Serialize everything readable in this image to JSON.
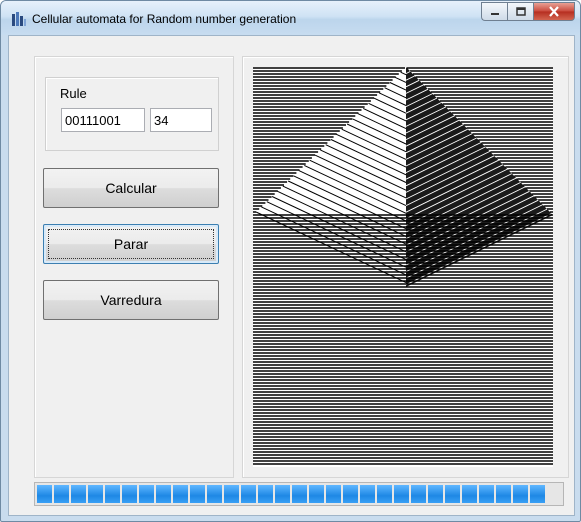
{
  "window": {
    "title": "Cellular automata for Random number generation"
  },
  "caption_buttons": {
    "minimize": "—",
    "maximize": "□",
    "close": "X"
  },
  "rule": {
    "label": "Rule",
    "bits": "00111001",
    "number": "34"
  },
  "buttons": {
    "calcular": "Calcular",
    "parar": "Parar",
    "varredura": "Varredura"
  },
  "progress": {
    "fraction": 1.0,
    "segments": 30
  },
  "colors": {
    "accent": "#1e88e5",
    "canvas_bg": "#ffffff",
    "cells": "#000000"
  },
  "icons": {
    "app": "app-icon"
  }
}
